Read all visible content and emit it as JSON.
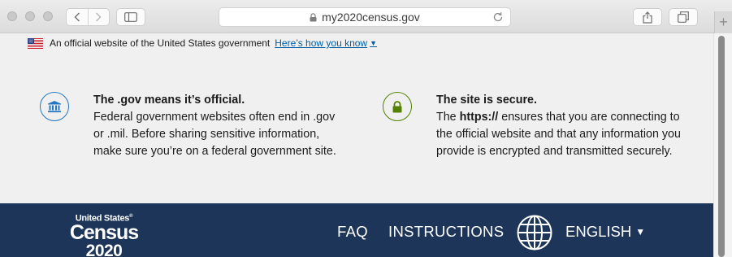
{
  "browser": {
    "url": "my2020census.gov",
    "buttons": [
      "back",
      "forward",
      "sidebar",
      "share",
      "tabs",
      "new-tab"
    ]
  },
  "gov_banner": {
    "official_text": "An official website of the United States government",
    "how_link": "Here’s how you know",
    "left": {
      "title": "The .gov means it’s official.",
      "body": "Federal government websites often end in .gov or .mil. Before sharing sensitive information, make sure you’re on a federal government site.",
      "icon": "government-building-icon",
      "color": "#2378c3"
    },
    "right": {
      "title": "The site is secure.",
      "body_prefix": "The ",
      "body_strong": "https://",
      "body_suffix": " ensures that you are connecting to the official website and that any information you provide is encrypted and transmitted securely.",
      "icon": "lock-icon",
      "color": "#538200"
    }
  },
  "header": {
    "logo": {
      "line1": "United States",
      "line2": "Census",
      "line3": "2020"
    },
    "nav": {
      "faq": "FAQ",
      "instructions": "INSTRUCTIONS",
      "language": "ENGLISH"
    },
    "background": "#1c3558"
  }
}
